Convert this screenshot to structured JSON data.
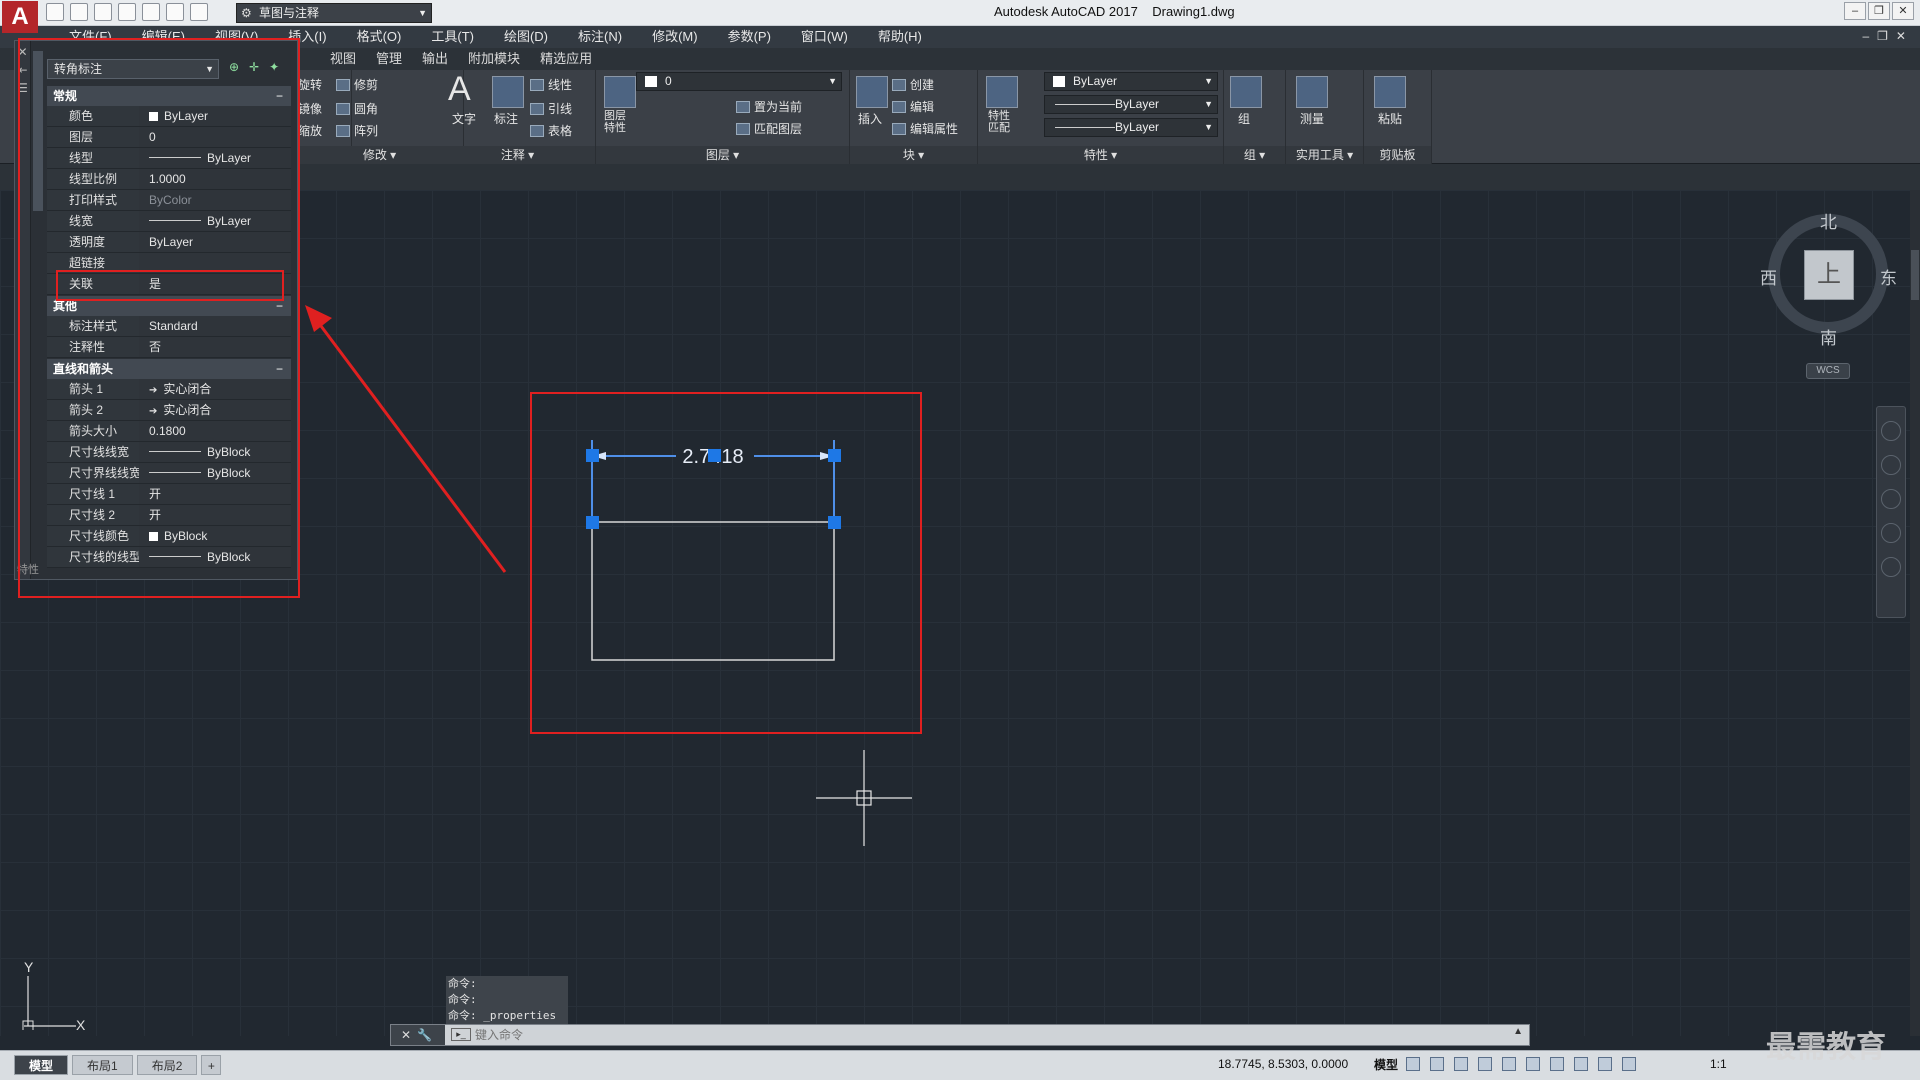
{
  "app": {
    "title": "Autodesk AutoCAD 2017    Drawing1.dwg",
    "logo_letter": "A",
    "workspace": "草图与注释"
  },
  "menus": [
    "文件(F)",
    "编辑(E)",
    "视图(V)",
    "插入(I)",
    "格式(O)",
    "工具(T)",
    "绘图(D)",
    "标注(N)",
    "修改(M)",
    "参数(P)",
    "窗口(W)",
    "帮助(H)"
  ],
  "ribbon_tabs": [
    "视图",
    "管理",
    "输出",
    "附加模块",
    "精选应用"
  ],
  "ribbon": {
    "modify": {
      "title": "修改",
      "rotate": "旋转",
      "trim": "修剪",
      "mirror": "镜像",
      "fillet": "圆角",
      "scale": "缩放",
      "array": "阵列"
    },
    "annotation": {
      "title": "注释",
      "text": "文字",
      "dimension": "标注",
      "linear": "线性",
      "leader": "引线",
      "table": "表格"
    },
    "layers": {
      "title": "图层",
      "layer_props": "图层\n特性",
      "current_layer": "0",
      "set_current": "置为当前",
      "match_layer": "匹配图层"
    },
    "block": {
      "title": "块",
      "insert": "插入",
      "create": "创建",
      "edit": "编辑",
      "edit_attr": "编辑属性"
    },
    "properties": {
      "title": "特性",
      "match": "特性\n匹配",
      "color": "ByLayer",
      "linetype": "ByLayer",
      "lineweight": "ByLayer"
    },
    "groups": {
      "title": "组",
      "group": "组"
    },
    "utilities": {
      "title": "实用工具",
      "measure": "测量"
    },
    "clipboard": {
      "title": "剪贴板",
      "paste": "粘贴"
    }
  },
  "properties_palette": {
    "selection": "转角标注",
    "side_label": "特性",
    "categories": [
      {
        "name": "常规",
        "toggle": "−",
        "rows": [
          {
            "name": "颜色",
            "value": "ByLayer",
            "kind": "swatch"
          },
          {
            "name": "图层",
            "value": "0",
            "kind": "text"
          },
          {
            "name": "线型",
            "value": "ByLayer",
            "kind": "line"
          },
          {
            "name": "线型比例",
            "value": "1.0000",
            "kind": "text"
          },
          {
            "name": "打印样式",
            "value": "ByColor",
            "kind": "dim"
          },
          {
            "name": "线宽",
            "value": "ByLayer",
            "kind": "line"
          },
          {
            "name": "透明度",
            "value": "ByLayer",
            "kind": "text"
          },
          {
            "name": "超链接",
            "value": "",
            "kind": "text"
          },
          {
            "name": "关联",
            "value": "是",
            "kind": "text"
          }
        ]
      },
      {
        "name": "其他",
        "toggle": "−",
        "rows": [
          {
            "name": "标注样式",
            "value": "Standard",
            "kind": "text"
          },
          {
            "name": "注释性",
            "value": "否",
            "kind": "text"
          }
        ]
      },
      {
        "name": "直线和箭头",
        "toggle": "−",
        "rows": [
          {
            "name": "箭头 1",
            "value": "实心闭合",
            "kind": "arrow"
          },
          {
            "name": "箭头 2",
            "value": "实心闭合",
            "kind": "arrow"
          },
          {
            "name": "箭头大小",
            "value": "0.1800",
            "kind": "text"
          },
          {
            "name": "尺寸线线宽",
            "value": "ByBlock",
            "kind": "line"
          },
          {
            "name": "尺寸界线线宽",
            "value": "ByBlock",
            "kind": "line"
          },
          {
            "name": "尺寸线 1",
            "value": "开",
            "kind": "text"
          },
          {
            "name": "尺寸线 2",
            "value": "开",
            "kind": "text"
          },
          {
            "name": "尺寸线颜色",
            "value": "ByBlock",
            "kind": "swatch"
          },
          {
            "name": "尺寸线的线型",
            "value": "ByBlock",
            "kind": "line"
          }
        ]
      }
    ]
  },
  "drawing": {
    "dimension_text": "2.7418"
  },
  "viewcube": {
    "north": "北",
    "south": "南",
    "east": "东",
    "west": "西",
    "face": "上",
    "wcs": "WCS"
  },
  "ucs": {
    "x": "X",
    "y": "Y"
  },
  "command": {
    "history": [
      "命令:",
      "命令:",
      "命令: _properties"
    ],
    "placeholder": "键入命令"
  },
  "status": {
    "layout_tabs": [
      "模型",
      "布局1",
      "布局2"
    ],
    "add_tab": "+",
    "coords": "18.7745, 8.5303, 0.0000",
    "model": "模型",
    "scale": "1:1"
  },
  "watermark": "最需教育",
  "colors": {
    "highlight": "#e02020",
    "grip": "#1e78e6",
    "dimension": "#4f8fe8"
  }
}
